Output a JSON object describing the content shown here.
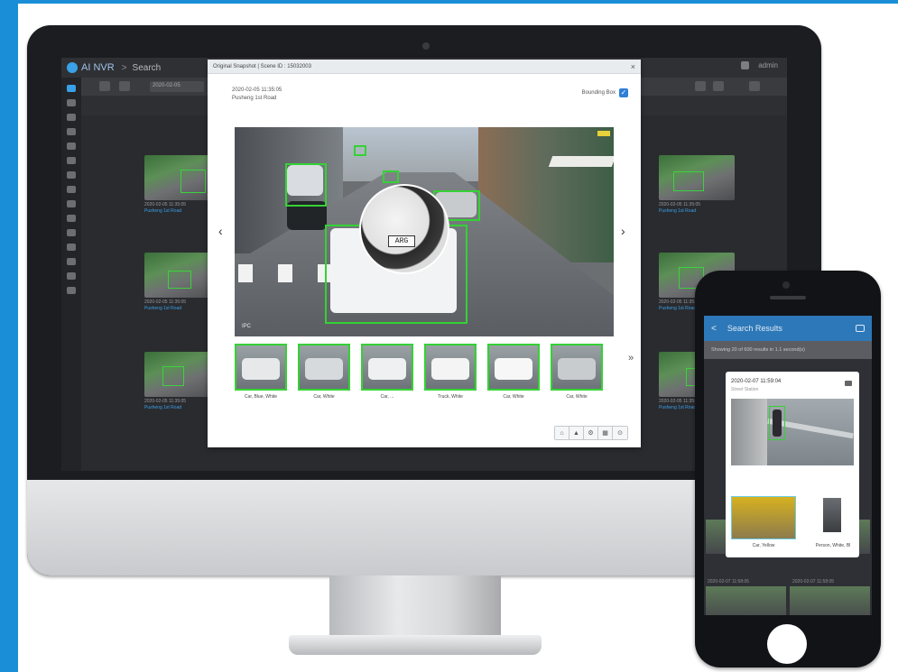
{
  "monitor": {
    "app": {
      "brand": "AI NVR",
      "separator": ">",
      "page": "Search",
      "user": "admin",
      "date_field": "2020-02-05"
    },
    "tiles": [
      {
        "date": "2020-02-05 11:35:05",
        "location": "Pusheng 1st Road"
      },
      {
        "date": "2020-02-05 11:35:05",
        "location": "Pusheng 1st Road"
      },
      {
        "date": "2020-02-05 11:35:05",
        "location": "Pusheng 1st Road"
      },
      {
        "date": "2020-02-05 11:35:05",
        "location": "Pusheng 1st Road"
      },
      {
        "date": "2020-02-05 11:35:05",
        "location": "Pusheng 1st Road"
      },
      {
        "date": "2020-02-05 11:35:05",
        "location": "Pusheng 1st Road"
      }
    ],
    "dialog": {
      "title": "Original Snapshot | Scene ID : 15032003",
      "close": "×",
      "timestamp": "2020-02-05 11:35:05",
      "location": "Pusheng 1st Road",
      "bounding_box_label": "Bounding Box",
      "bounding_box_checked": "✓",
      "plate": "ARG",
      "camera_label": "IPC",
      "prev": "‹",
      "next": "›",
      "expand": "»",
      "thumbnails": [
        {
          "label": "Car, Blue, White"
        },
        {
          "label": "Car, White"
        },
        {
          "label": "Car, ..."
        },
        {
          "label": "Truck, White"
        },
        {
          "label": "Car, White"
        },
        {
          "label": "Car, White"
        }
      ],
      "actions": [
        "⌂",
        "▲",
        "⚙",
        "▦",
        "⊙"
      ]
    }
  },
  "phone": {
    "back": "<",
    "title": "Search Results",
    "subtitle": "Showing 20 of 600 results in 1.1 second(s)",
    "card": {
      "timestamp": "2020-02-07 11:59:04",
      "location": "Street Station",
      "labels": [
        "Car, Yellow",
        "Person, White, Bl"
      ]
    },
    "captions": [
      "2020-02-07 11:58:05",
      "2020-02-07 11:58:05"
    ]
  }
}
